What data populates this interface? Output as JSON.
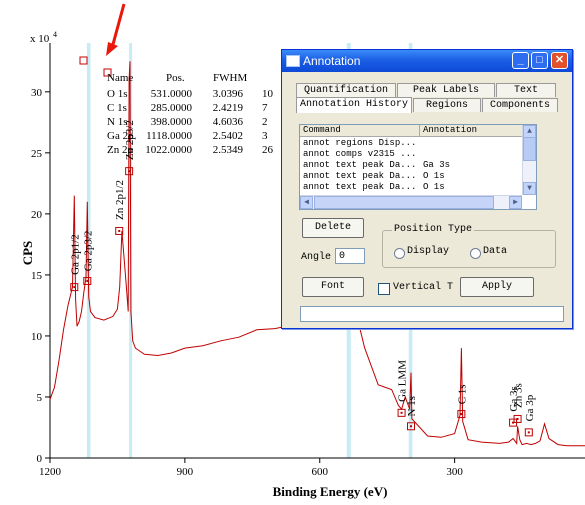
{
  "plot": {
    "y_scale_label": "x 10",
    "y_scale_exp": "4",
    "ylabel": "CPS",
    "xlabel": "Binding Energy (eV)",
    "x_ticks": [
      "1200",
      "900",
      "600",
      "300"
    ],
    "y_ticks": [
      "0",
      "5",
      "10",
      "15",
      "20",
      "25",
      "30"
    ],
    "peak_labels": [
      "Ga 2p1/2",
      "Ga 2p3/2",
      "Zn 2p1/2",
      "Zn 2p3/2",
      "Ga LMM",
      "N 1s",
      "C 1s",
      "Ga 3s",
      "Zn 3s",
      "Ga 3p"
    ],
    "table": {
      "headers": [
        "Name",
        "Pos.",
        "FWHM"
      ],
      "rows": [
        {
          "name": "O 1s",
          "pos": "531.0000",
          "fwhm": "3.0396",
          "extra": "10"
        },
        {
          "name": "C 1s",
          "pos": "285.0000",
          "fwhm": "2.4219",
          "extra": "7"
        },
        {
          "name": "N 1s",
          "pos": "398.0000",
          "fwhm": "4.6036",
          "extra": "2"
        },
        {
          "name": "Ga 2p",
          "pos": "1118.0000",
          "fwhm": "2.5402",
          "extra": "3"
        },
        {
          "name": "Zn 2p",
          "pos": "1022.0000",
          "fwhm": "2.5349",
          "extra": "26"
        }
      ]
    },
    "colors": {
      "spectrum": "#c00000",
      "marker": "#c00000",
      "band": "#c8ecf4",
      "arrow": "#e8180c"
    }
  },
  "chart_data": {
    "type": "line",
    "xlabel": "Binding Energy (eV)",
    "ylabel": "CPS",
    "y_multiplier": "x 10^4",
    "xlim": [
      1200,
      10
    ],
    "ylim": [
      0,
      34
    ],
    "x_ticks": [
      1200,
      900,
      600,
      300
    ],
    "y_ticks": [
      0,
      5,
      10,
      15,
      20,
      25,
      30
    ],
    "series": [
      {
        "x": [
          1200,
          1190,
          1180,
          1170,
          1160,
          1150,
          1146,
          1143,
          1140,
          1135,
          1130,
          1125,
          1120,
          1117,
          1114,
          1110,
          1100,
          1080,
          1060,
          1050,
          1045,
          1040,
          1030,
          1026,
          1024,
          1022,
          1020,
          1016,
          1010,
          990,
          960,
          930,
          900,
          860,
          820,
          780,
          740,
          700,
          660,
          620,
          580,
          560,
          550,
          540,
          535,
          531,
          528,
          520,
          500,
          470,
          440,
          425,
          418,
          410,
          400,
          397,
          395,
          390,
          360,
          330,
          300,
          288,
          285,
          282,
          270,
          240,
          200,
          180,
          170,
          162,
          160,
          155,
          150,
          140,
          130,
          120,
          110,
          105,
          100,
          90,
          70,
          50,
          30,
          10
        ],
        "y": [
          4.8,
          5.8,
          8.0,
          10.5,
          12.5,
          14.0,
          21.5,
          13.0,
          10.8,
          11.2,
          12.0,
          13.5,
          14.8,
          21.0,
          13.2,
          12.0,
          11.5,
          11.3,
          11.6,
          12.2,
          14.0,
          18.6,
          14.0,
          12.0,
          31.0,
          32.5,
          12.0,
          9.6,
          9.0,
          8.5,
          8.4,
          8.6,
          9.0,
          9.2,
          9.6,
          9.9,
          10.5,
          10.6,
          10.9,
          11.0,
          11.3,
          11.8,
          13.0,
          18.0,
          24.0,
          26.0,
          19.0,
          12.0,
          9.0,
          6.0,
          5.6,
          4.3,
          4.0,
          5.0,
          4.0,
          7.0,
          3.2,
          3.0,
          1.8,
          1.7,
          2.0,
          3.5,
          9.0,
          3.0,
          1.5,
          1.3,
          1.2,
          1.3,
          1.6,
          1.2,
          2.6,
          1.5,
          1.1,
          1.2,
          1.1,
          1.2,
          1.4,
          2.1,
          2.8,
          1.6,
          1.1,
          1.0,
          1.0,
          1.0
        ]
      }
    ],
    "annotations": [
      "Ga 2p1/2",
      "Ga 2p3/2",
      "Zn 2p1/2",
      "Zn 2p3/2",
      "Ga LMM",
      "N 1s",
      "C 1s",
      "Ga 3s",
      "Zn 3s",
      "Ga 3p"
    ]
  },
  "dialog": {
    "title": "Annotation",
    "tabs_row1": [
      "Quantification",
      "Peak Labels",
      "Text"
    ],
    "tabs_row2": [
      "Annotation History",
      "Regions",
      "Components"
    ],
    "list_headers": [
      "Command",
      "Annotation"
    ],
    "list_rows": [
      {
        "command": "annot regions Disp...",
        "annotation": ""
      },
      {
        "command": "annot comps v2315 ...",
        "annotation": ""
      },
      {
        "command": "annot text peak Da...",
        "annotation": "Ga 3s"
      },
      {
        "command": "annot text peak Da...",
        "annotation": "O 1s"
      },
      {
        "command": "annot text peak Da...",
        "annotation": "O 1s"
      }
    ],
    "delete_label": "Delete",
    "angle_label": "Angle",
    "angle_value": "0",
    "position_type_label": "Position Type",
    "radio_display": "Display",
    "radio_data": "Data",
    "font_label": "Font",
    "vertical_label": "Vertical T",
    "apply_label": "Apply",
    "text_value": ""
  }
}
